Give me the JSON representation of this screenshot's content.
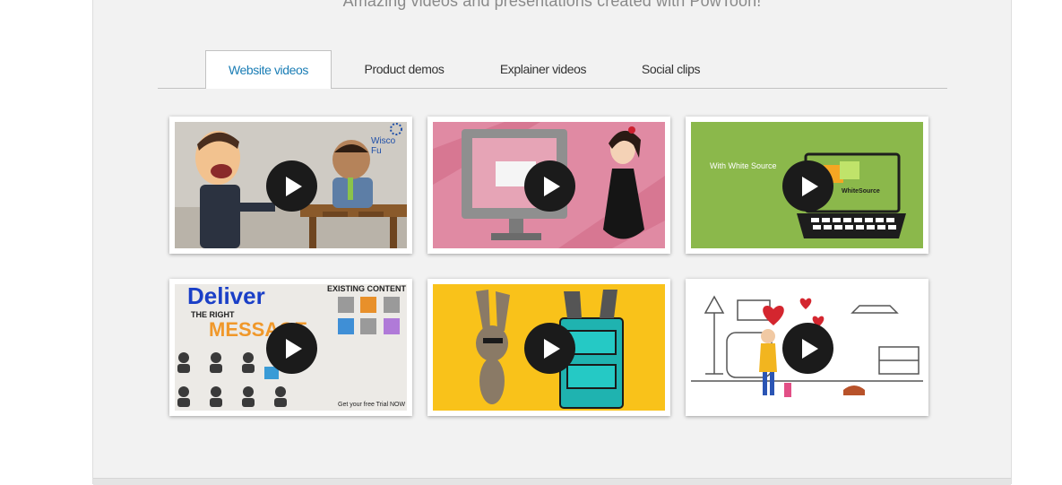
{
  "header": {
    "tagline": "Amazing videos and presentations created with PowToon!"
  },
  "tabs": [
    {
      "label": "Website videos",
      "active": true
    },
    {
      "label": "Product demos",
      "active": false
    },
    {
      "label": "Explainer videos",
      "active": false
    },
    {
      "label": "Social clips",
      "active": false
    }
  ],
  "videos": [
    {
      "overlay_text": "Wisco Fu",
      "play_icon": "play-icon"
    },
    {
      "overlay_text": "",
      "play_icon": "play-icon"
    },
    {
      "overlay_text": "With White Source",
      "badge_text": "WhiteSource",
      "play_icon": "play-icon"
    },
    {
      "title_line1": "Deliver",
      "title_line2": "THE RIGHT",
      "title_line3": "MESSAGE",
      "side_heading": "EXISTING CONTENT",
      "footer_text": "Get your free Trial NOW",
      "play_icon": "play-icon"
    },
    {
      "overlay_text": "",
      "play_icon": "play-icon"
    },
    {
      "overlay_text": "",
      "play_icon": "play-icon"
    }
  ],
  "colors": {
    "accent": "#1a7db5",
    "panel_background": "#f2f2f2",
    "play_button": "#1b1b1b"
  }
}
